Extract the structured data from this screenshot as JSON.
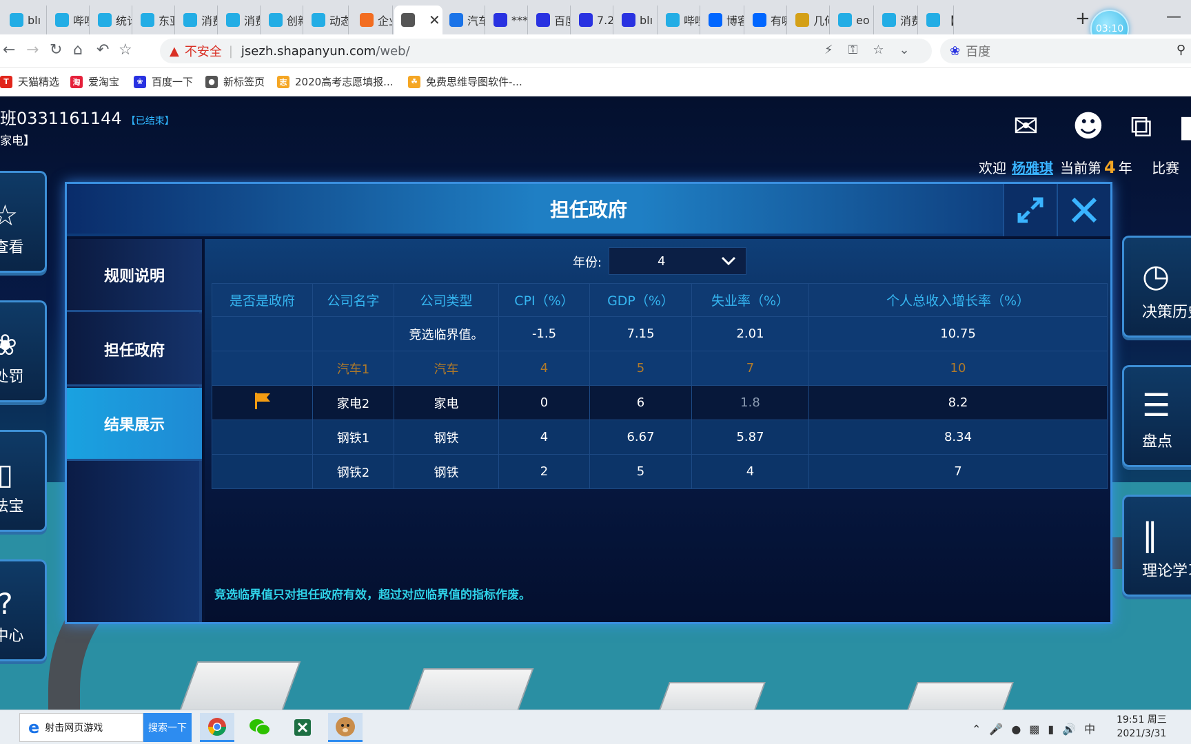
{
  "browser": {
    "tabs": [
      {
        "label": "blı",
        "icon": "bilibili-icon",
        "color": "#23ade5"
      },
      {
        "label": "哔哩",
        "icon": "bilibili-icon",
        "color": "#23ade5"
      },
      {
        "label": "统计",
        "icon": "bilibili-icon",
        "color": "#23ade5"
      },
      {
        "label": "东亚",
        "icon": "bilibili-icon",
        "color": "#23ade5"
      },
      {
        "label": "消费",
        "icon": "bilibili-icon",
        "color": "#23ade5"
      },
      {
        "label": "消费",
        "icon": "bilibili-icon",
        "color": "#23ade5"
      },
      {
        "label": "创新",
        "icon": "bilibili-icon",
        "color": "#23ade5"
      },
      {
        "label": "动态",
        "icon": "bilibili-icon",
        "color": "#23ade5"
      },
      {
        "label": "企业",
        "icon": "orange-circle-icon",
        "color": "#f26d21"
      },
      {
        "label": "",
        "icon": "globe-icon",
        "color": "#555555",
        "active": true
      },
      {
        "label": "汽车",
        "icon": "dot-icon",
        "color": "#1a73e8"
      },
      {
        "label": "***",
        "icon": "baidu-paw-icon",
        "color": "#2932e1"
      },
      {
        "label": "百度",
        "icon": "baidu-paw-icon",
        "color": "#2932e1"
      },
      {
        "label": "7.2",
        "icon": "baidu-paw-icon",
        "color": "#2932e1"
      },
      {
        "label": "blı",
        "icon": "baidu-paw-icon",
        "color": "#2932e1"
      },
      {
        "label": "哔哩",
        "icon": "bilibili-icon",
        "color": "#23ade5"
      },
      {
        "label": "博客",
        "icon": "zhihu-icon",
        "color": "#0066ff"
      },
      {
        "label": "有哪",
        "icon": "zhihu-icon",
        "color": "#0066ff"
      },
      {
        "label": "几何",
        "icon": "colorful-icon",
        "color": "#d4a017"
      },
      {
        "label": "eo",
        "icon": "bilibili-icon",
        "color": "#23ade5"
      },
      {
        "label": "消费",
        "icon": "bilibili-icon",
        "color": "#23ade5"
      },
      {
        "label": "【",
        "icon": "bilibili-icon",
        "color": "#23ade5"
      }
    ],
    "tab_close": "✕",
    "new_tab": "+",
    "timer": "03:10",
    "minimize": "—",
    "url_warning": "不安全",
    "url_separator": "|",
    "url_host": "jsezh.shapanyun.com",
    "url_path": "/web/",
    "search_placeholder": "百度",
    "bookmarks": [
      {
        "label": "天猫精选",
        "icon": "tmall-icon",
        "color": "#e1251b",
        "glyph": "T"
      },
      {
        "label": "爱淘宝",
        "icon": "taobao-icon",
        "color": "#e5203a",
        "glyph": "淘"
      },
      {
        "label": "百度一下",
        "icon": "baidu-paw-icon",
        "color": "#2932e1",
        "glyph": "❀"
      },
      {
        "label": "新标签页",
        "icon": "globe-icon",
        "color": "#555555",
        "glyph": "●"
      },
      {
        "label": "2020高考志愿填报...",
        "icon": "gaokao-icon",
        "color": "#f5a623",
        "glyph": "志"
      },
      {
        "label": "免费思维导图软件-...",
        "icon": "mindmap-icon",
        "color": "#f5a623",
        "glyph": "☘"
      }
    ]
  },
  "game": {
    "class_title": "班0331161144",
    "class_status": "【已结束】",
    "class_sub": "家电】",
    "welcome": "欢迎",
    "username": "杨雅琪",
    "year_prefix": "当前第",
    "year_value": "4",
    "year_suffix": "年",
    "match_label": "比赛",
    "left_buttons": [
      {
        "label": "查看",
        "icon": "star-badge-icon",
        "glyph": "☆"
      },
      {
        "label": "处罚",
        "icon": "ribbon-icon",
        "glyph": "❀"
      },
      {
        "label": "法宝",
        "icon": "book-icon",
        "glyph": "▯"
      },
      {
        "label": "中心",
        "icon": "help-icon",
        "glyph": "?"
      }
    ],
    "right_buttons": [
      {
        "label": "决策历史",
        "icon": "history-icon",
        "glyph": "◷"
      },
      {
        "label": "盘点",
        "icon": "document-icon",
        "glyph": "☰"
      },
      {
        "label": "理论学习",
        "icon": "books-icon",
        "glyph": "‖"
      }
    ]
  },
  "modal": {
    "title": "担任政府",
    "menu": [
      {
        "label": "规则说明",
        "active": false
      },
      {
        "label": "担任政府",
        "active": false
      },
      {
        "label": "结果展示",
        "active": true
      }
    ],
    "year_label": "年份:",
    "year_value": "4",
    "columns": [
      "是否是政府",
      "公司名字",
      "公司类型",
      "CPI（%）",
      "GDP（%）",
      "失业率（%）",
      "个人总收入增长率（%）"
    ],
    "rows": [
      {
        "gov": "",
        "name": "",
        "type": "竞选临界值。",
        "cpi": "-1.5",
        "gdp": "7.15",
        "unemp": "2.01",
        "income": "10.75"
      },
      {
        "gov": "",
        "name": "汽车1",
        "type": "汽车",
        "cpi": "4",
        "gdp": "5",
        "unemp": "7",
        "income": "10"
      },
      {
        "gov": "flag",
        "name": "家电2",
        "type": "家电",
        "cpi": "0",
        "gdp": "6",
        "unemp": "1.8",
        "income": "8.2"
      },
      {
        "gov": "",
        "name": "钢铁1",
        "type": "钢铁",
        "cpi": "4",
        "gdp": "6.67",
        "unemp": "5.87",
        "income": "8.34"
      },
      {
        "gov": "",
        "name": "钢铁2",
        "type": "钢铁",
        "cpi": "2",
        "gdp": "5",
        "unemp": "4",
        "income": "7"
      }
    ],
    "note": "竞选临界值只对担任政府有效，超过对应临界值的指标作废。"
  },
  "taskbar": {
    "search_text": "射击网页游戏",
    "search_button": "搜索一下",
    "ime": "中",
    "time": "19:51 周三",
    "date": "2021/3/31"
  }
}
